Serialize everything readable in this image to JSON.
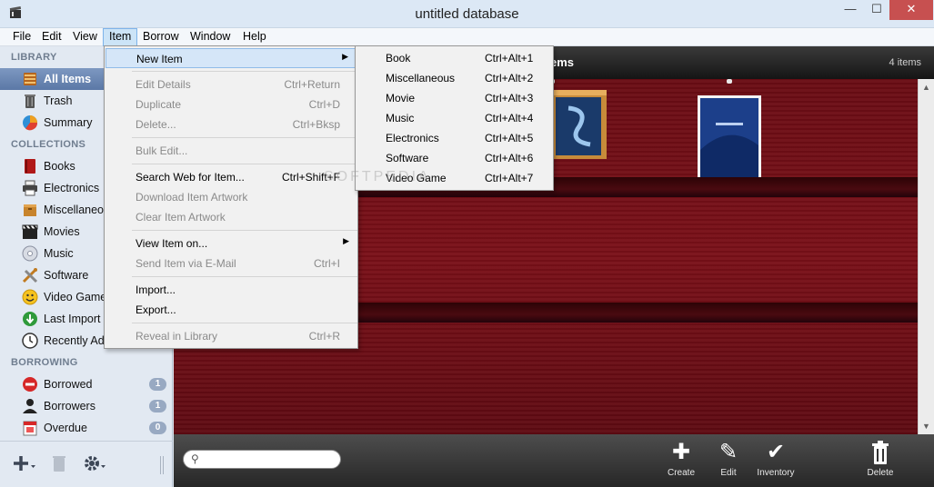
{
  "window": {
    "title": "untitled database",
    "min": "—",
    "max": "☐",
    "close": "✕"
  },
  "menubar": [
    "File",
    "Edit",
    "View",
    "Item",
    "Borrow",
    "Window",
    "Help"
  ],
  "sidebar": {
    "library_head": "LIBRARY",
    "library": [
      {
        "label": "All Items",
        "icon": "all-items-icon"
      },
      {
        "label": "Trash",
        "icon": "trash-icon"
      },
      {
        "label": "Summary",
        "icon": "pie-chart-icon"
      }
    ],
    "collections_head": "COLLECTIONS",
    "collections": [
      {
        "label": "Books",
        "icon": "book-icon"
      },
      {
        "label": "Electronics",
        "icon": "printer-icon"
      },
      {
        "label": "Miscellaneous",
        "icon": "box-icon"
      },
      {
        "label": "Movies",
        "icon": "clapperboard-icon"
      },
      {
        "label": "Music",
        "icon": "cd-icon"
      },
      {
        "label": "Software",
        "icon": "tools-icon"
      },
      {
        "label": "Video Games",
        "icon": "smiley-icon"
      },
      {
        "label": "Last Import",
        "icon": "download-icon"
      },
      {
        "label": "Recently Added",
        "icon": "clock-icon"
      }
    ],
    "borrowing_head": "BORROWING",
    "borrowing": [
      {
        "label": "Borrowed",
        "icon": "no-entry-icon",
        "count": "1"
      },
      {
        "label": "Borrowers",
        "icon": "person-icon",
        "count": "1"
      },
      {
        "label": "Overdue",
        "icon": "calendar-icon",
        "count": "0"
      }
    ]
  },
  "main": {
    "header_title": "ems",
    "header_count": "4 items"
  },
  "toolbar": {
    "search_placeholder": "",
    "create": "Create",
    "edit": "Edit",
    "inventory": "Inventory",
    "delete": "Delete"
  },
  "item_menu": {
    "new_item": "New Item",
    "edit_details": "Edit Details",
    "edit_details_sc": "Ctrl+Return",
    "duplicate": "Duplicate",
    "duplicate_sc": "Ctrl+D",
    "delete": "Delete...",
    "delete_sc": "Ctrl+Bksp",
    "bulk_edit": "Bulk Edit...",
    "search_web": "Search Web for Item...",
    "search_web_sc": "Ctrl+Shift+F",
    "download_artwork": "Download Item Artwork",
    "clear_artwork": "Clear Item Artwork",
    "view_on": "View Item on...",
    "send_email": "Send Item via E-Mail",
    "send_email_sc": "Ctrl+I",
    "import": "Import...",
    "export": "Export...",
    "reveal": "Reveal in Library",
    "reveal_sc": "Ctrl+R"
  },
  "new_item_submenu": [
    {
      "label": "Book",
      "shortcut": "Ctrl+Alt+1"
    },
    {
      "label": "Miscellaneous",
      "shortcut": "Ctrl+Alt+2"
    },
    {
      "label": "Movie",
      "shortcut": "Ctrl+Alt+3"
    },
    {
      "label": "Music",
      "shortcut": "Ctrl+Alt+4"
    },
    {
      "label": "Electronics",
      "shortcut": "Ctrl+Alt+5"
    },
    {
      "label": "Software",
      "shortcut": "Ctrl+Alt+6"
    },
    {
      "label": "Video Game",
      "shortcut": "Ctrl+Alt+7"
    }
  ],
  "watermark": "SOFTPEDIA"
}
